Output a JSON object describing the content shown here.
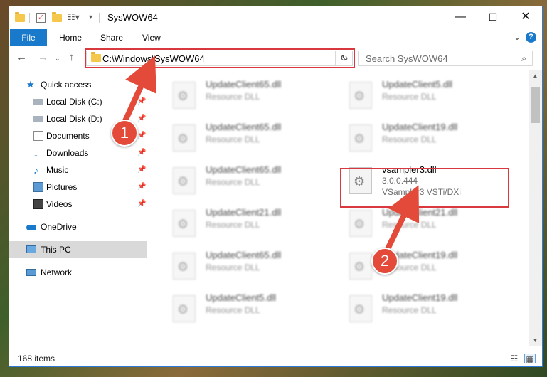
{
  "window": {
    "title": "SysWOW64",
    "controls": {
      "minimize": "—",
      "maximize": "☐",
      "close": "✕"
    }
  },
  "ribbon": {
    "tabs": [
      "File",
      "Home",
      "Share",
      "View"
    ],
    "expand_icon": "chevron-down-icon",
    "help_label": "?"
  },
  "address_bar": {
    "path": "C:\\Windows\\SysWOW64",
    "dropdown": "⌄",
    "refresh": "↻"
  },
  "search": {
    "placeholder": "Search SysWOW64",
    "icon": "⌕"
  },
  "nav_pane": {
    "items": [
      {
        "label": "Quick access",
        "icon": "star-icon"
      },
      {
        "label": "Local Disk (C:)",
        "icon": "drive-icon",
        "pinned": true
      },
      {
        "label": "Local Disk (D:)",
        "icon": "drive-icon",
        "pinned": true
      },
      {
        "label": "Documents",
        "icon": "documents-icon",
        "pinned": true
      },
      {
        "label": "Downloads",
        "icon": "downloads-icon",
        "pinned": true
      },
      {
        "label": "Music",
        "icon": "music-icon",
        "pinned": true
      },
      {
        "label": "Pictures",
        "icon": "pictures-icon",
        "pinned": true
      },
      {
        "label": "Videos",
        "icon": "videos-icon",
        "pinned": true
      },
      {
        "label": "OneDrive",
        "icon": "onedrive-icon"
      },
      {
        "label": "This PC",
        "icon": "pc-icon",
        "selected": true
      },
      {
        "label": "Network",
        "icon": "network-icon"
      }
    ]
  },
  "files": {
    "left": [
      {
        "name": "UpdateClient65.dll",
        "desc": "Resource DLL"
      },
      {
        "name": "UpdateClient65.dll",
        "desc": "Resource DLL"
      },
      {
        "name": "UpdateClient65.dll",
        "desc": "Resource DLL"
      },
      {
        "name": "UpdateClient21.dll",
        "desc": "Resource DLL"
      },
      {
        "name": "UpdateClient65.dll",
        "desc": "Resource DLL"
      },
      {
        "name": "UpdateClient5.dll",
        "desc": "Resource DLL"
      }
    ],
    "right": [
      {
        "name": "UpdateClient5.dll",
        "desc": "Resource DLL"
      },
      {
        "name": "UpdateClient19.dll",
        "desc": "Resource DLL"
      },
      {
        "name": "vsampler3.dll",
        "version": "3.0.0.444",
        "desc": "VSampler3 VSTi/DXi"
      },
      {
        "name": "UpdateClient21.dll",
        "desc": "Resource DLL"
      },
      {
        "name": "UpdateClient19.dll",
        "desc": "Resource DLL"
      },
      {
        "name": "UpdateClient19.dll",
        "desc": "Resource DLL"
      }
    ]
  },
  "status": {
    "item_count": "168 items"
  },
  "annotations": {
    "step1": "1",
    "step2": "2",
    "color": "#e44a3a"
  }
}
